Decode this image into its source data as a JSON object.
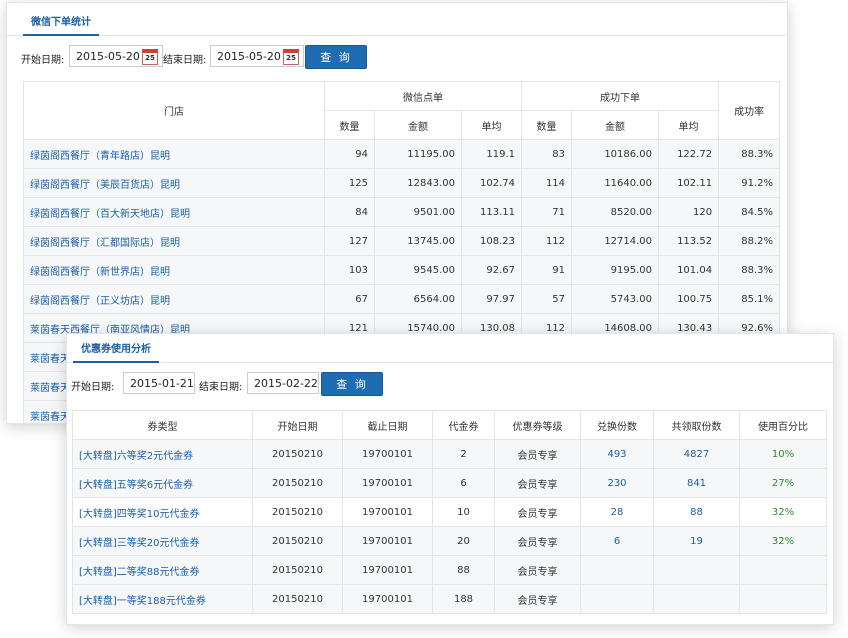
{
  "panel1": {
    "tab": "微信下单统计",
    "filter": {
      "start_label": "开始日期:",
      "start_value": "2015-05-20",
      "end_label": "结束日期:",
      "end_value": "2015-05-20",
      "cal_day": "25",
      "query_btn": "查 询"
    },
    "headers": {
      "store": "门店",
      "wechat_group": "微信点单",
      "success_group": "成功下单",
      "rate": "成功率",
      "count": "数量",
      "amount": "金额",
      "avg": "单均"
    },
    "rows": [
      {
        "store": "绿茵阁西餐厅（青年路店）昆明",
        "c1": "94",
        "a1": "11195.00",
        "v1": "119.1",
        "c2": "83",
        "a2": "10186.00",
        "v2": "122.72",
        "rate": "88.3%"
      },
      {
        "store": "绿茵阁西餐厅（美辰百货店）昆明",
        "c1": "125",
        "a1": "12843.00",
        "v1": "102.74",
        "c2": "114",
        "a2": "11640.00",
        "v2": "102.11",
        "rate": "91.2%"
      },
      {
        "store": "绿茵阁西餐厅（百大新天地店）昆明",
        "c1": "84",
        "a1": "9501.00",
        "v1": "113.11",
        "c2": "71",
        "a2": "8520.00",
        "v2": "120",
        "rate": "84.5%"
      },
      {
        "store": "绿茵阁西餐厅（汇都国际店）昆明",
        "c1": "127",
        "a1": "13745.00",
        "v1": "108.23",
        "c2": "112",
        "a2": "12714.00",
        "v2": "113.52",
        "rate": "88.2%"
      },
      {
        "store": "绿茵阁西餐厅（新世界店）昆明",
        "c1": "103",
        "a1": "9545.00",
        "v1": "92.67",
        "c2": "91",
        "a2": "9195.00",
        "v2": "101.04",
        "rate": "88.3%"
      },
      {
        "store": "绿茵阁西餐厅（正义坊店）昆明",
        "c1": "67",
        "a1": "6564.00",
        "v1": "97.97",
        "c2": "57",
        "a2": "5743.00",
        "v2": "100.75",
        "rate": "85.1%"
      },
      {
        "store": "莱茵春天西餐厅（南亚风情店）昆明",
        "c1": "121",
        "a1": "15740.00",
        "v1": "130.08",
        "c2": "112",
        "a2": "14608.00",
        "v2": "130.43",
        "rate": "92.6%"
      },
      {
        "store": "莱茵春天",
        "c1": "",
        "a1": "",
        "v1": "",
        "c2": "",
        "a2": "",
        "v2": "",
        "rate": ""
      },
      {
        "store": "莱茵春天",
        "c1": "",
        "a1": "",
        "v1": "",
        "c2": "",
        "a2": "",
        "v2": "",
        "rate": ""
      },
      {
        "store": "莱茵春天",
        "c1": "",
        "a1": "",
        "v1": "",
        "c2": "",
        "a2": "",
        "v2": "",
        "rate": ""
      }
    ]
  },
  "panel2": {
    "tab": "优惠券使用分析",
    "filter": {
      "start_label": "开始日期:",
      "start_value": "2015-01-21",
      "end_label": "结束日期:",
      "end_value": "2015-02-22",
      "query_btn": "查 询"
    },
    "headers": [
      "券类型",
      "开始日期",
      "截止日期",
      "代金券",
      "优惠券等级",
      "兑换份数",
      "共领取份数",
      "使用百分比"
    ],
    "rows": [
      {
        "type": "[大转盘]六等奖2元代金券",
        "start": "20150210",
        "end": "19700101",
        "value": "2",
        "level": "会员专享",
        "redeemed": "493",
        "received": "4827",
        "pct": "10%"
      },
      {
        "type": "[大转盘]五等奖6元代金券",
        "start": "20150210",
        "end": "19700101",
        "value": "6",
        "level": "会员专享",
        "redeemed": "230",
        "received": "841",
        "pct": "27%"
      },
      {
        "type": "[大转盘]四等奖10元代金券",
        "start": "20150210",
        "end": "19700101",
        "value": "10",
        "level": "会员专享",
        "redeemed": "28",
        "received": "88",
        "pct": "32%"
      },
      {
        "type": "[大转盘]三等奖20元代金券",
        "start": "20150210",
        "end": "19700101",
        "value": "20",
        "level": "会员专享",
        "redeemed": "6",
        "received": "19",
        "pct": "32%"
      },
      {
        "type": "[大转盘]二等奖88元代金券",
        "start": "20150210",
        "end": "19700101",
        "value": "88",
        "level": "会员专享",
        "redeemed": "",
        "received": "",
        "pct": ""
      },
      {
        "type": "[大转盘]一等奖188元代金券",
        "start": "20150210",
        "end": "19700101",
        "value": "188",
        "level": "会员专享",
        "redeemed": "",
        "received": "",
        "pct": ""
      }
    ]
  }
}
